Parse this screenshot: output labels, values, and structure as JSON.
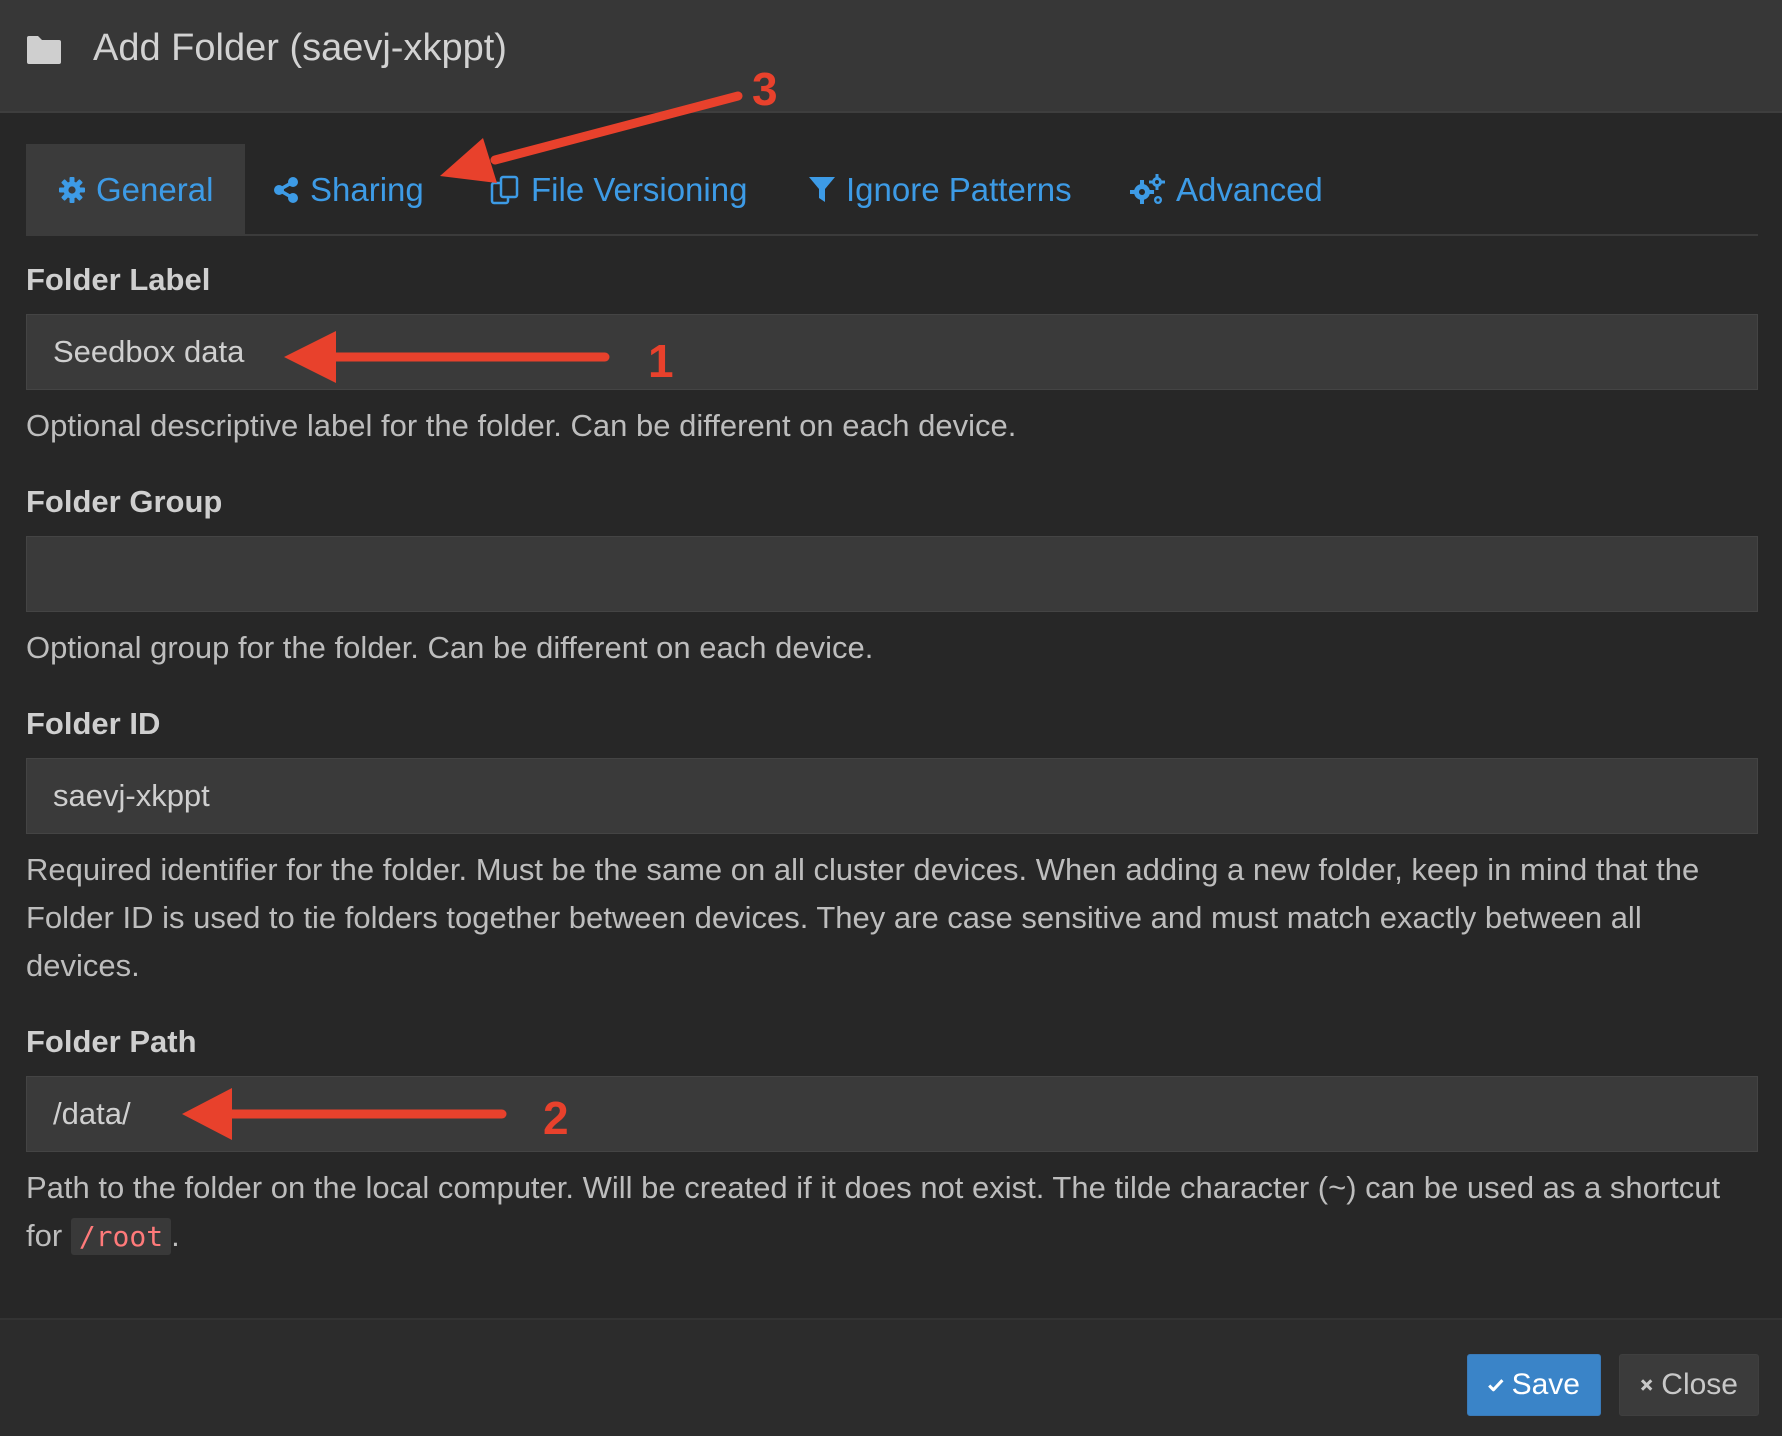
{
  "header": {
    "title": "Add Folder (saevj-xkppt)",
    "icon": "folder-icon"
  },
  "tabs": [
    {
      "label": "General",
      "icon": "cog-icon",
      "active": true
    },
    {
      "label": "Sharing",
      "icon": "share-icon",
      "active": false
    },
    {
      "label": "File Versioning",
      "icon": "copy-icon",
      "active": false
    },
    {
      "label": "Ignore Patterns",
      "icon": "filter-icon",
      "active": false
    },
    {
      "label": "Advanced",
      "icon": "cogs-icon",
      "active": false
    }
  ],
  "form": {
    "folder_label": {
      "label": "Folder Label",
      "value": "Seedbox data",
      "help": "Optional descriptive label for the folder. Can be different on each device."
    },
    "folder_group": {
      "label": "Folder Group",
      "value": "",
      "help": "Optional group for the folder. Can be different on each device."
    },
    "folder_id": {
      "label": "Folder ID",
      "value": "saevj-xkppt",
      "help": "Required identifier for the folder. Must be the same on all cluster devices. When adding a new folder, keep in mind that the Folder ID is used to tie folders together between devices. They are case sensitive and must match exactly between all devices."
    },
    "folder_path": {
      "label": "Folder Path",
      "value": "/data/",
      "help_prefix": "Path to the folder on the local computer. Will be created if it does not exist. The tilde character (~) can be used as a shortcut for",
      "help_code": "/root",
      "help_suffix": "."
    }
  },
  "footer": {
    "save_label": "Save",
    "close_label": "Close"
  },
  "annotations": {
    "one": "1",
    "two": "2",
    "three": "3",
    "color": "#e8412c"
  },
  "colors": {
    "background": "#272727",
    "header": "#373737",
    "input": "#3a3a3a",
    "link": "#3d9be6",
    "primary_button": "#3a84c8",
    "code": "#ff7a7a"
  }
}
